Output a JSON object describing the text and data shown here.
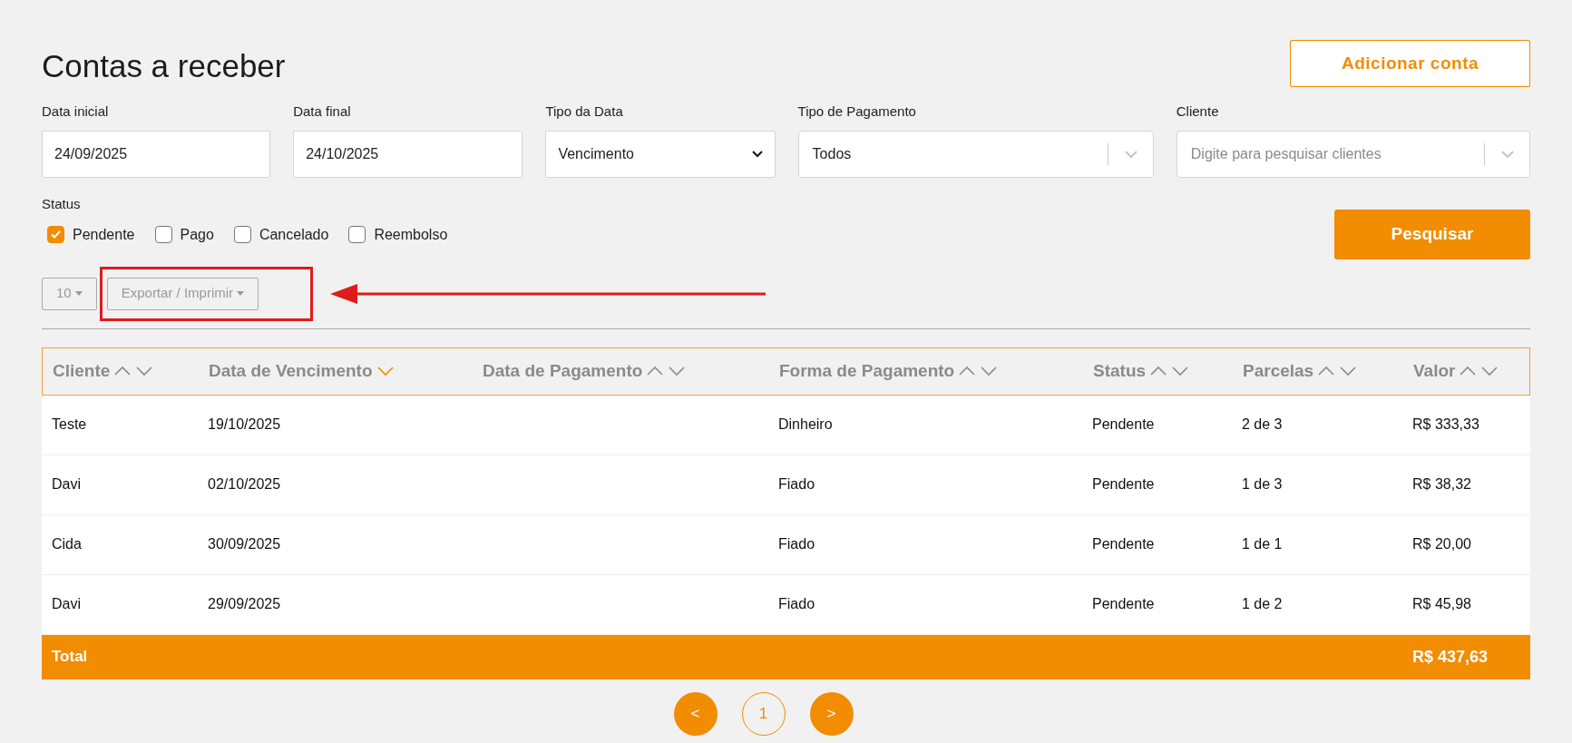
{
  "title": "Contas a receber",
  "add_button": "Adicionar conta",
  "filters": [
    {
      "kind": "date",
      "label": "Data inicial",
      "value": "24/09/2025"
    },
    {
      "kind": "date",
      "label": "Data final",
      "value": "24/10/2025"
    },
    {
      "kind": "select",
      "label": "Tipo da Data",
      "value": "Vencimento"
    },
    {
      "kind": "combo",
      "label": "Tipo de Pagamento",
      "value": "Todos"
    },
    {
      "kind": "combo",
      "label": "Cliente",
      "placeholder": "Digite para pesquisar clientes"
    }
  ],
  "status": {
    "label": "Status",
    "options": [
      {
        "label": "Pendente",
        "checked": true
      },
      {
        "label": "Pago",
        "checked": false
      },
      {
        "label": "Cancelado",
        "checked": false
      },
      {
        "label": "Reembolso",
        "checked": false
      }
    ]
  },
  "search_button": "Pesquisar",
  "page_size": "10",
  "export_button": "Exportar / Imprimir",
  "table": {
    "columns": [
      {
        "label": "Cliente",
        "sorted": false
      },
      {
        "label": "Data de Vencimento",
        "sorted": true
      },
      {
        "label": "Data de Pagamento",
        "sorted": false
      },
      {
        "label": "Forma de Pagamento",
        "sorted": false
      },
      {
        "label": "Status",
        "sorted": false
      },
      {
        "label": "Parcelas",
        "sorted": false
      },
      {
        "label": "Valor",
        "sorted": false
      }
    ],
    "rows": [
      [
        "Teste",
        "19/10/2025",
        "",
        "Dinheiro",
        "Pendente",
        "2 de 3",
        "R$ 333,33"
      ],
      [
        "Davi",
        "02/10/2025",
        "",
        "Fiado",
        "Pendente",
        "1 de 3",
        "R$ 38,32"
      ],
      [
        "Cida",
        "30/09/2025",
        "",
        "Fiado",
        "Pendente",
        "1 de 1",
        "R$ 20,00"
      ],
      [
        "Davi",
        "29/09/2025",
        "",
        "Fiado",
        "Pendente",
        "1 de 2",
        "R$ 45,98"
      ]
    ],
    "total": {
      "label": "Total",
      "value": "R$ 437,63"
    }
  },
  "pagination": [
    {
      "label": "<",
      "selected": false
    },
    {
      "label": "1",
      "selected": true
    },
    {
      "label": ">",
      "selected": false
    }
  ]
}
